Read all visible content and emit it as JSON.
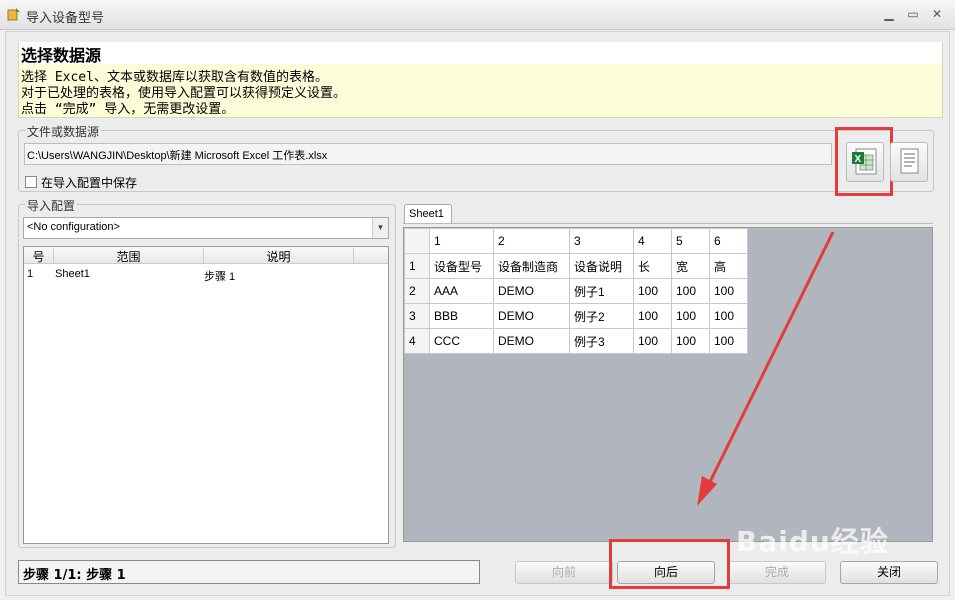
{
  "window": {
    "title": "导入设备型号"
  },
  "header": {
    "title": "选择数据源",
    "lines": [
      "选择 Excel、文本或数据库以获取含有数值的表格。",
      "对于已处理的表格，使用导入配置可以获得预定义设置。",
      "点击 “完成” 导入，无需更改设置。"
    ]
  },
  "source": {
    "group_label": "文件或数据源",
    "path": "C:\\Users\\WANGJIN\\Desktop\\新建 Microsoft Excel 工作表.xlsx",
    "save_checkbox_label": "在导入配置中保存",
    "save_checked": false
  },
  "import_config": {
    "group_label": "导入配置",
    "selected": "<No configuration>",
    "columns": [
      "号",
      "范围",
      "说明"
    ],
    "rows": [
      [
        "1",
        "Sheet1",
        "步骤 1"
      ]
    ]
  },
  "sheet": {
    "tab": "Sheet1",
    "col_headers": [
      "1",
      "2",
      "3",
      "4",
      "5",
      "6"
    ],
    "rows": [
      {
        "num": "1",
        "cells": [
          "设备型号",
          "设备制造商",
          "设备说明",
          "长",
          "宽",
          "高"
        ]
      },
      {
        "num": "2",
        "cells": [
          "AAA",
          "DEMO",
          "例子1",
          "100",
          "100",
          "100"
        ]
      },
      {
        "num": "3",
        "cells": [
          "BBB",
          "DEMO",
          "例子2",
          "100",
          "100",
          "100"
        ]
      },
      {
        "num": "4",
        "cells": [
          "CCC",
          "DEMO",
          "例子3",
          "100",
          "100",
          "100"
        ]
      }
    ]
  },
  "status": {
    "text": "步骤 1/1: 步骤 1"
  },
  "buttons": {
    "prev": "向前",
    "next": "向后",
    "finish": "完成",
    "close": "关闭"
  },
  "watermark": "Baidu经验",
  "colors": {
    "highlight": "#e23c3c",
    "header_bg": "#fdfdd9",
    "grid_bg": "#b1b5be"
  }
}
